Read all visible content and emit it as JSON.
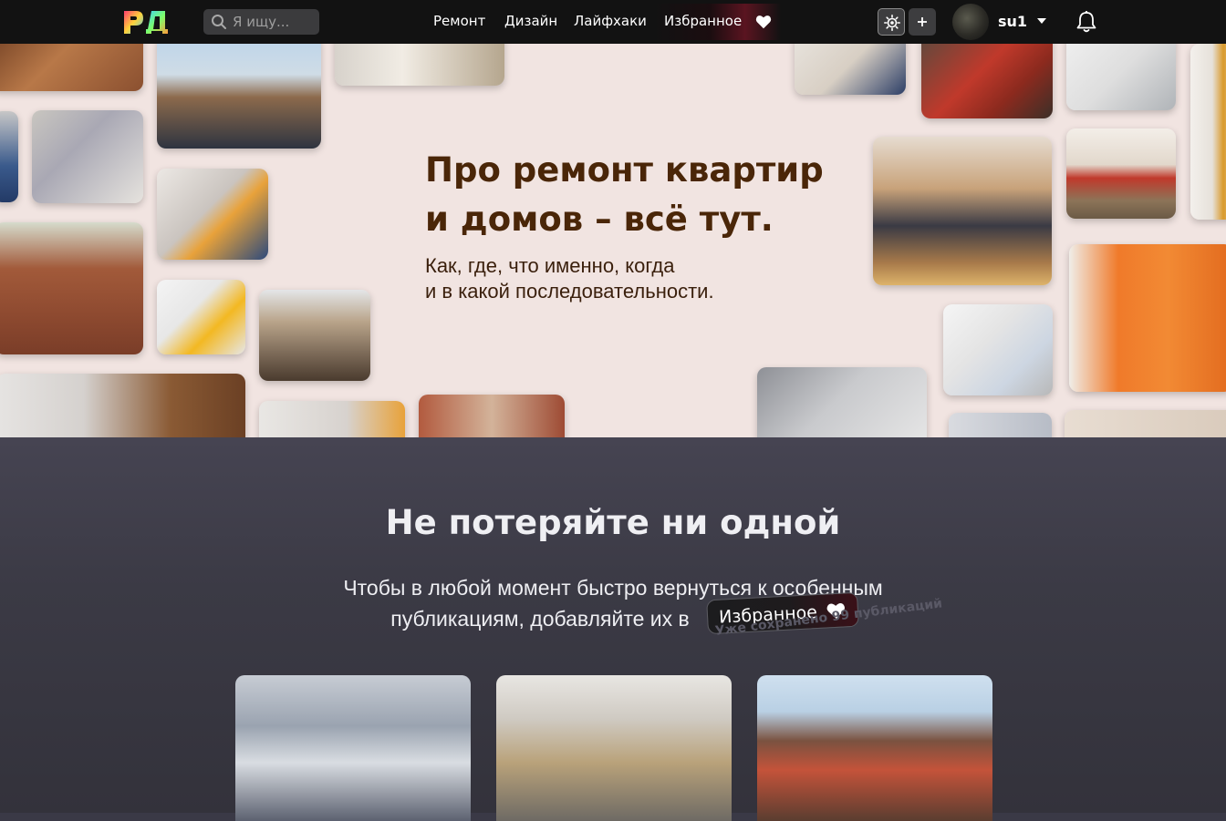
{
  "header": {
    "logo_alt": "РД",
    "search": {
      "placeholder": "Я ищу...",
      "value": ""
    },
    "nav": [
      {
        "label": "Ремонт"
      },
      {
        "label": "Дизайн"
      },
      {
        "label": "Лайфхаки"
      },
      {
        "label": "Избранное"
      }
    ],
    "username": "su1",
    "icons": [
      "search-icon",
      "heart-icon",
      "theme-toggle-icon",
      "plus-icon",
      "avatar",
      "chevron-down-icon",
      "bell-icon"
    ]
  },
  "hero": {
    "title_line1": "Про ремонт квартир",
    "title_line2": "и домов – всё тут.",
    "subtitle_line1": "Как, где, что именно, когда",
    "subtitle_line2": "и в какой последовательности."
  },
  "favorites": {
    "title": "Не потеряйте ни одной",
    "text_line1": "Чтобы в любой момент быстро вернуться к особенным",
    "text_line2": "публикациям, добавляйте их в",
    "badge_label": "Избранное",
    "saved_note": "Уже сохранено 99 публикаций"
  },
  "colors": {
    "header_bg": "#121212",
    "hero_bg": "#f1e4e1",
    "hero_title": "#4a2608",
    "section_bg": "#3b3a45",
    "accent_red": "#5a1420"
  }
}
